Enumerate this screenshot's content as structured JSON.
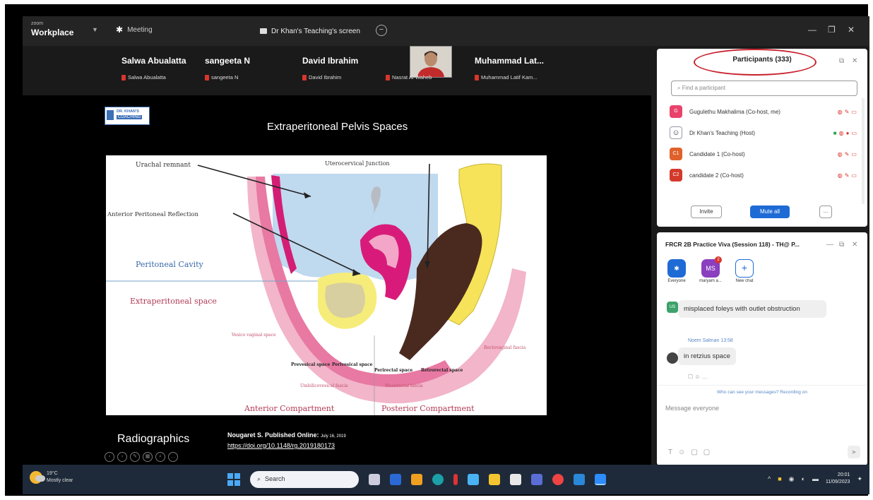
{
  "app": {
    "brand_small": "zoom",
    "brand_name": "Workplace",
    "tab_meeting": "Meeting",
    "tab_screen": "Dr Khan's Teaching's screen"
  },
  "video_strip": {
    "tiles": [
      {
        "name": "Salwa Abualatta",
        "sub": "Salwa Abualatta"
      },
      {
        "name": "sangeeta N",
        "sub": "sangeeta N"
      },
      {
        "name": "David Ibrahim",
        "sub": "David Ibrahim"
      },
      {
        "name": "",
        "sub": "Nasrat Al-Waheb"
      },
      {
        "name": "Muhammad Lat...",
        "sub": "Muhammad Latif Kam..."
      }
    ]
  },
  "slide": {
    "logo_line1": "DR. KHAN'S",
    "logo_line2": "COACHING",
    "title": "Extraperitoneal Pelvis Spaces",
    "credit": "Radiographics",
    "ref": "Nougaret S. Published Online:",
    "ref_date": "July 16, 2019",
    "link": "https://doi.org/10.1148/rg.2019180173",
    "labels": {
      "urachal": "Urachal remnant",
      "uterocervical": "Uterocervical Junction",
      "anterior_reflection": "Anterior Peritoneal Reflection",
      "peritoneal_cavity": "Peritoneal Cavity",
      "extraperitoneal": "Extraperitoneal space",
      "vesicovaginal": "Vesico vaginal space",
      "rectovaginal": "Rectovaginal fascia",
      "prevesical": "Prevesical space",
      "perivesical": "Perivesical space",
      "perirectal": "Perirectal space",
      "retrorectal": "Retrorectal space",
      "umbilicovesical": "Umbilicovesical fascia",
      "mesorectal": "Mesorectal fascia",
      "anterior_comp": "Anterior Compartment",
      "posterior_comp": "Posterior Compartment"
    }
  },
  "participants": {
    "title": "Participants (333)",
    "search_placeholder": "Find a participant",
    "items": [
      {
        "initial": "G",
        "name": "Gugulethu Makhalima (Co-host, me)",
        "color": "#e8436b"
      },
      {
        "initial": "",
        "name": "Dr Khan's Teaching (Host)",
        "color": "#ffffff"
      },
      {
        "initial": "C1",
        "name": "Candidate 1 (Co-host)",
        "color": "#e0612b"
      },
      {
        "initial": "C2",
        "name": "candidate 2 (Co-host)",
        "color": "#d33a2c"
      }
    ],
    "invite": "Invite",
    "mute_all": "Mute all",
    "more": "..."
  },
  "chat": {
    "title": "FRCR 2B Practice Viva (Session 118) - TH@ P...",
    "rooms": [
      {
        "label": "Everyone",
        "initials": "",
        "color": "#1f6bd6"
      },
      {
        "label": "maryam a...",
        "initials": "MS",
        "color": "#8a3fbf"
      },
      {
        "label": "New chat",
        "initials": "+",
        "color": "#ffffff"
      }
    ],
    "badge": "2",
    "msg1_initials": "US",
    "msg1_text": "misplaced foleys with outlet obstruction",
    "msg2_sender": "Noem Salman",
    "msg2_time": "13:58",
    "msg2_text": "in retzius space",
    "notice": "Who can see your messages? Recording on",
    "input_placeholder": "Message everyone"
  },
  "taskbar": {
    "temp": "19°C",
    "weather": "Mostly clear",
    "search": "Search",
    "time": "20:01",
    "date": "11/09/2023"
  },
  "colors": {
    "accent": "#1f6bd6",
    "highlight_ellipse": "#c8202c"
  }
}
